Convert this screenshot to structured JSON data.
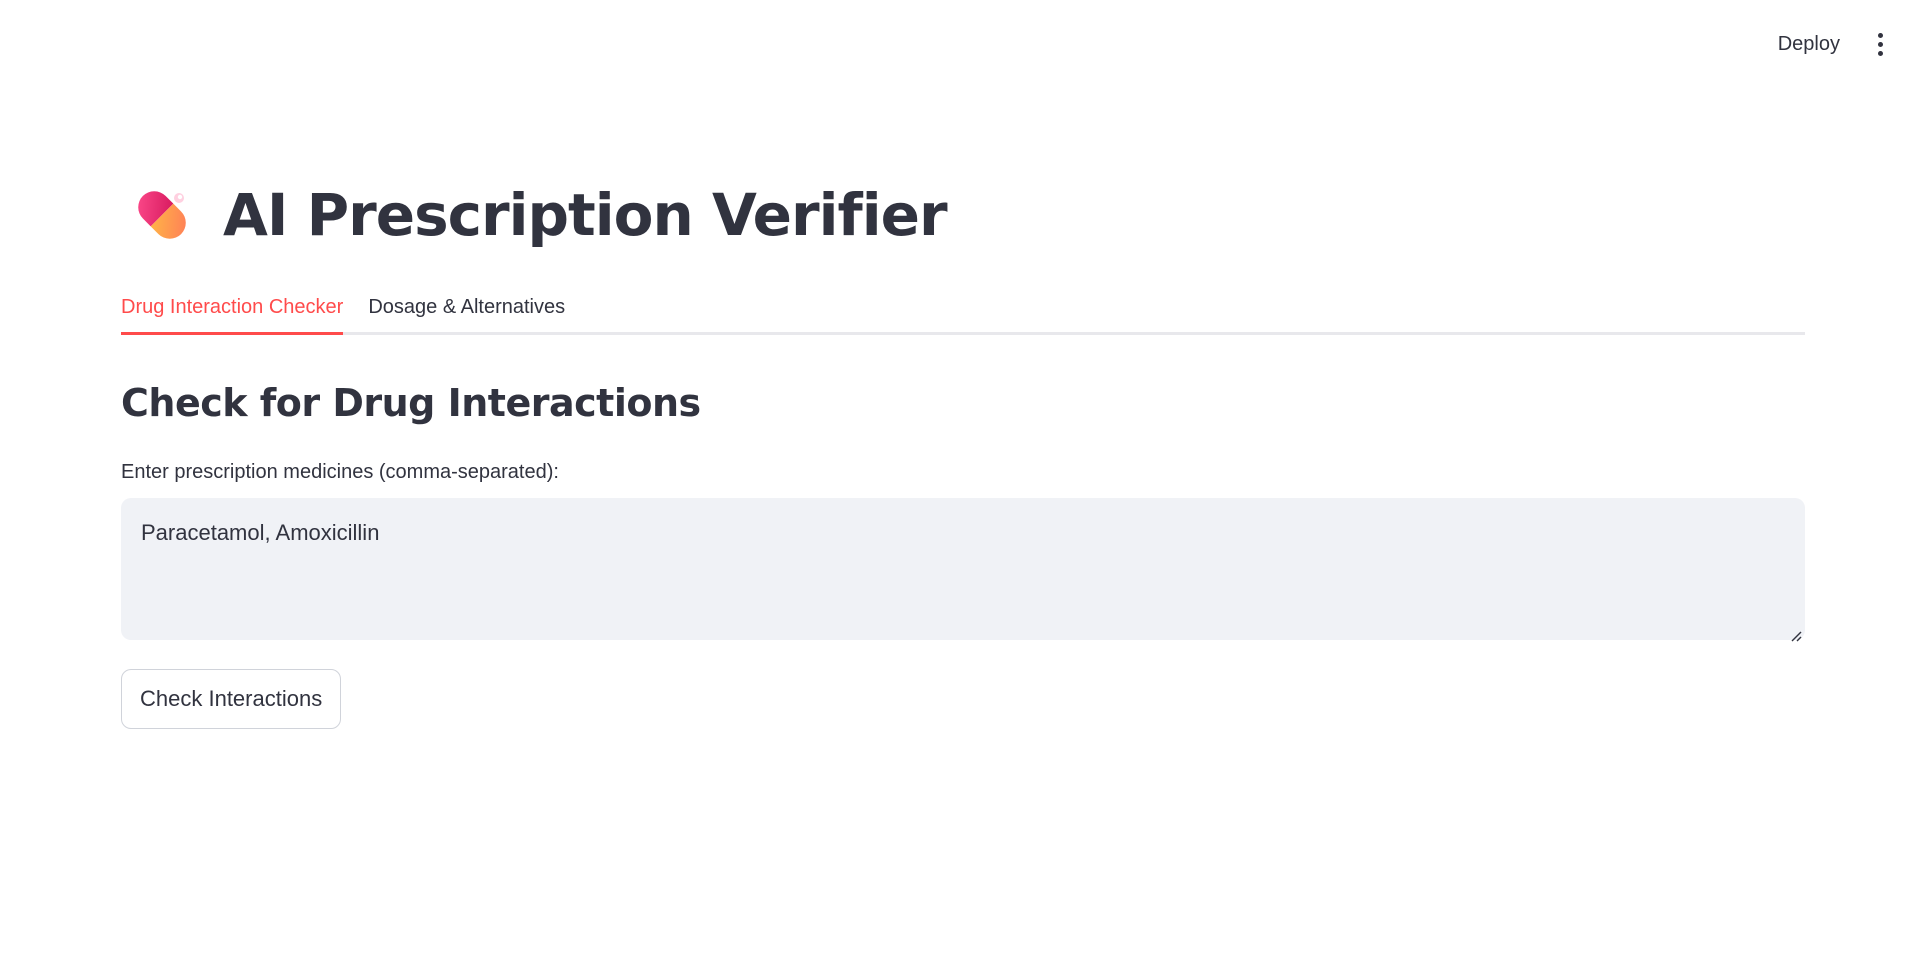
{
  "toolbar": {
    "deploy_label": "Deploy",
    "menu_icon": "vertical-ellipsis-icon"
  },
  "header": {
    "icon": "pill-icon",
    "title": "AI Prescription Verifier"
  },
  "tabs": [
    {
      "label": "Drug Interaction Checker",
      "active": true
    },
    {
      "label": "Dosage & Alternatives",
      "active": false
    }
  ],
  "section": {
    "heading": "Check for Drug Interactions",
    "input_label": "Enter prescription medicines (comma-separated):",
    "input_value": "Paracetamol, Amoxicillin",
    "button_label": "Check Interactions"
  },
  "colors": {
    "accent": "#ff4b4b",
    "text": "#31333f",
    "input_bg": "#f0f2f6"
  }
}
